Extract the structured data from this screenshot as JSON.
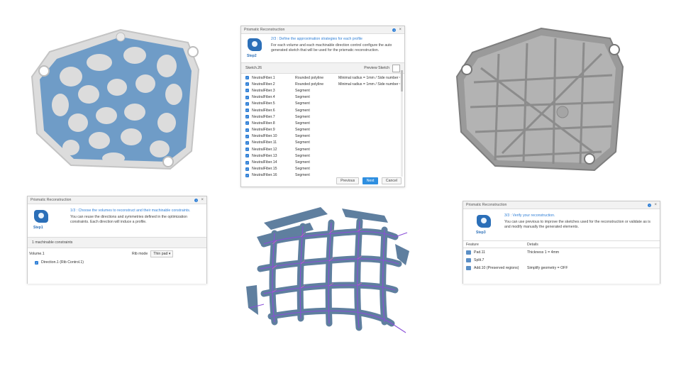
{
  "step2_dialog": {
    "title": "Prismatic Reconstruction",
    "step_label": "Step2",
    "heading": "2/3 : Define the approximation strategies for each profile",
    "desc": "For each volume and each machinable direction control configure the auto generated sketch that will be used for the prismatic reconstruction.",
    "sketch_name": "Sketch.26",
    "preview_button": "Preview Sketch",
    "rows": [
      {
        "name": "NeutralFiber.1",
        "strategy": "Rounded polyline",
        "params": "Minimal radius = 1mm / Side number = ..."
      },
      {
        "name": "NeutralFiber.2",
        "strategy": "Rounded polyline",
        "params": "Minimal radius = 1mm / Side number = ..."
      },
      {
        "name": "NeutralFiber.3",
        "strategy": "Segment",
        "params": ""
      },
      {
        "name": "NeutralFiber.4",
        "strategy": "Segment",
        "params": ""
      },
      {
        "name": "NeutralFiber.5",
        "strategy": "Segment",
        "params": ""
      },
      {
        "name": "NeutralFiber.6",
        "strategy": "Segment",
        "params": ""
      },
      {
        "name": "NeutralFiber.7",
        "strategy": "Segment",
        "params": ""
      },
      {
        "name": "NeutralFiber.8",
        "strategy": "Segment",
        "params": ""
      },
      {
        "name": "NeutralFiber.9",
        "strategy": "Segment",
        "params": ""
      },
      {
        "name": "NeutralFiber.10",
        "strategy": "Segment",
        "params": ""
      },
      {
        "name": "NeutralFiber.11",
        "strategy": "Segment",
        "params": ""
      },
      {
        "name": "NeutralFiber.12",
        "strategy": "Segment",
        "params": ""
      },
      {
        "name": "NeutralFiber.13",
        "strategy": "Segment",
        "params": ""
      },
      {
        "name": "NeutralFiber.14",
        "strategy": "Segment",
        "params": ""
      },
      {
        "name": "NeutralFiber.15",
        "strategy": "Segment",
        "params": ""
      },
      {
        "name": "NeutralFiber.16",
        "strategy": "Segment",
        "params": ""
      }
    ],
    "buttons": {
      "previous": "Previous",
      "next": "Next",
      "cancel": "Cancel"
    }
  },
  "step1_dialog": {
    "title": "Prismatic Reconstruction",
    "step_label": "Step1",
    "heading": "1/3 : Choose the volumes to reconstruct and their machinable constraints.",
    "desc": "You can reuse the directions and symmetries defined in the optimization constraints. Each direction will induce a profile.",
    "constraints_bar": "1 machinable constraints",
    "volume_label": "Volume.1",
    "rib_mode_label": "Rib mode",
    "rib_mode_value": "Thin pad",
    "direction_item": "Direction.1 (Rib Control.1)"
  },
  "step3_dialog": {
    "title": "Prismatic Reconstruction",
    "step_label": "Step3",
    "heading": "3/3 : Verify your reconstruction.",
    "desc": "You can use previous to improve the sketches used for the reconstruction or validate as is and modify manually the generated elements.",
    "columns": {
      "feature": "Feature",
      "details": "Details"
    },
    "rows": [
      {
        "feature": "Pad.11",
        "details": "Thickness 1 = 4mm"
      },
      {
        "feature": "Split.7",
        "details": ""
      },
      {
        "feature": "Add.10 (Preserved regions)",
        "details": "Simplify geometry = OFF"
      }
    ]
  },
  "colors": {
    "accent": "#2f7fd6",
    "rib_blue": "#6f9cc7",
    "part_gray": "#9a9a9a",
    "fiber_purple": "#8a4fd8"
  }
}
